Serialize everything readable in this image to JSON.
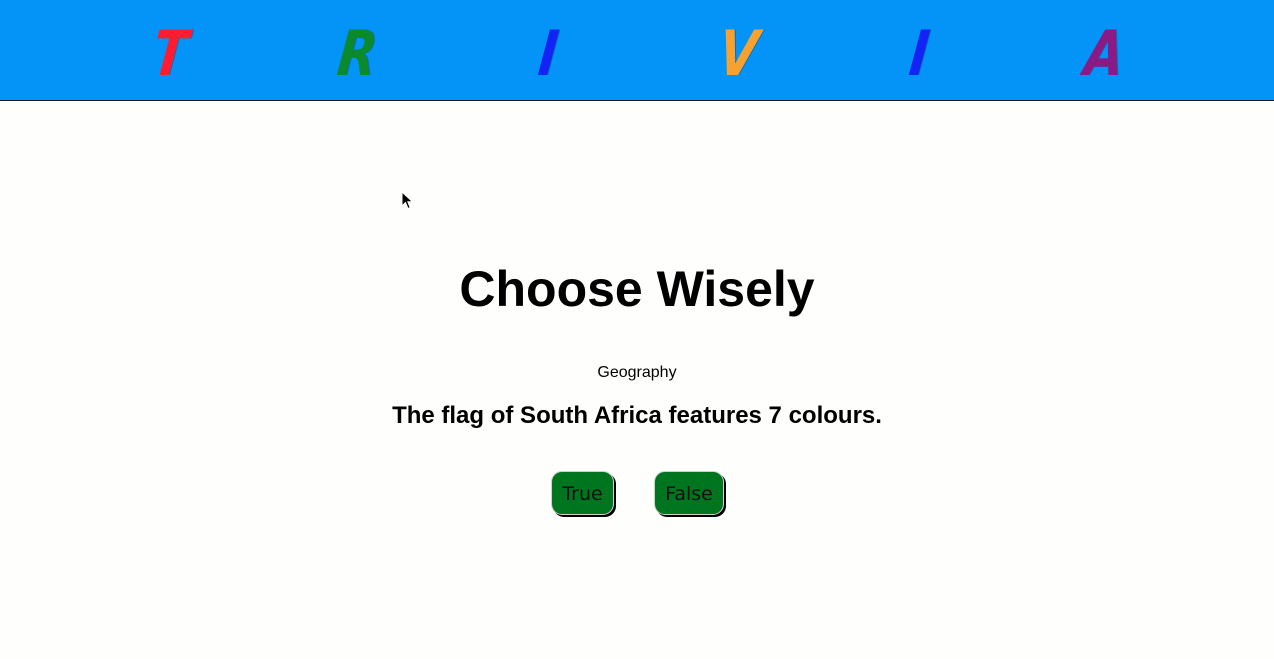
{
  "banner": {
    "letters": [
      {
        "char": "T",
        "color": "#ff1c33"
      },
      {
        "char": "R",
        "color": "#0a8a2c"
      },
      {
        "char": "I",
        "color": "#1323f5"
      },
      {
        "char": "V",
        "color": "#f7a230"
      },
      {
        "char": "I",
        "color": "#1323f5"
      },
      {
        "char": "A",
        "color": "#8a1a86"
      }
    ],
    "background": "#0494f7"
  },
  "main": {
    "heading": "Choose Wisely",
    "category": "Geography",
    "question": "The flag of South Africa features 7 colours.",
    "answers": {
      "true_label": "True",
      "false_label": "False"
    },
    "button_color": "#007520"
  },
  "cursor_icon": "arrow-cursor-icon"
}
